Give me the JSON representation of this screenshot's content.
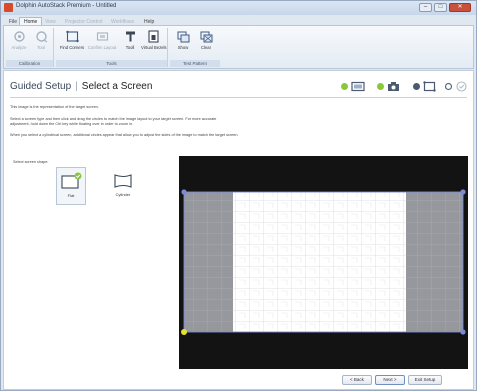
{
  "window": {
    "title": "Dolphin AutoStack Premium - Untitled",
    "minimize_glyph": "–",
    "maximize_glyph": "□",
    "close_glyph": "✕"
  },
  "menu": {
    "tabs": [
      {
        "label": "File",
        "state": "normal"
      },
      {
        "label": "Home",
        "state": "active"
      },
      {
        "label": "View",
        "state": "dim"
      },
      {
        "label": "Projector Control",
        "state": "dim"
      },
      {
        "label": "Workflows",
        "state": "dim"
      },
      {
        "label": "Help",
        "state": "normal"
      }
    ]
  },
  "ribbon": {
    "groups": [
      {
        "label": "Calibration",
        "buttons": [
          {
            "label": "Analyze",
            "icon": "analyze-icon",
            "dim": true
          },
          {
            "label": "Tool",
            "icon": "tool-icon",
            "dim": true
          }
        ]
      },
      {
        "label": "Tools",
        "buttons": [
          {
            "label": "Find Corners",
            "icon": "find-corners-icon",
            "dim": false
          },
          {
            "label": "Confirm Layout",
            "icon": "confirm-layout-icon",
            "dim": true
          },
          {
            "label": "Tooll",
            "icon": "tooll-icon",
            "dim": false
          },
          {
            "label": "Virtual Bezels",
            "icon": "virtual-bezels-icon",
            "dim": false
          }
        ]
      },
      {
        "label": "Test Pattern",
        "buttons": [
          {
            "label": "Show",
            "icon": "show-pattern-icon",
            "dim": false
          },
          {
            "label": "Clear",
            "icon": "clear-pattern-icon",
            "dim": false
          }
        ]
      }
    ]
  },
  "guided": {
    "title": "Guided Setup",
    "separator": "|",
    "subtitle": "Select a Screen",
    "desc_1": "This image is the representation of the target screen.",
    "desc_2": "Select a screen type and then click and drag the circles to match the image layout to your target screen. For more accurate",
    "desc_3": "adjustment, hold down the Ctrl key while floating over in order to zoom in.",
    "desc_4": "When you select a cylindrical screen, additional circles appear that allow you to adjust the sides of the image to match the target screen.",
    "shape_label": "Select screen shape:",
    "shapes": [
      {
        "label": "Flat",
        "selected": true
      },
      {
        "label": "Cylinder",
        "selected": false
      }
    ]
  },
  "footer": {
    "back": "< Back",
    "next": "Next >",
    "exit": "Exit Setup"
  },
  "colors": {
    "accent_green": "#8cc63f",
    "handle_blue": "#7a8ad8",
    "handle_yellow": "#e8e030"
  }
}
